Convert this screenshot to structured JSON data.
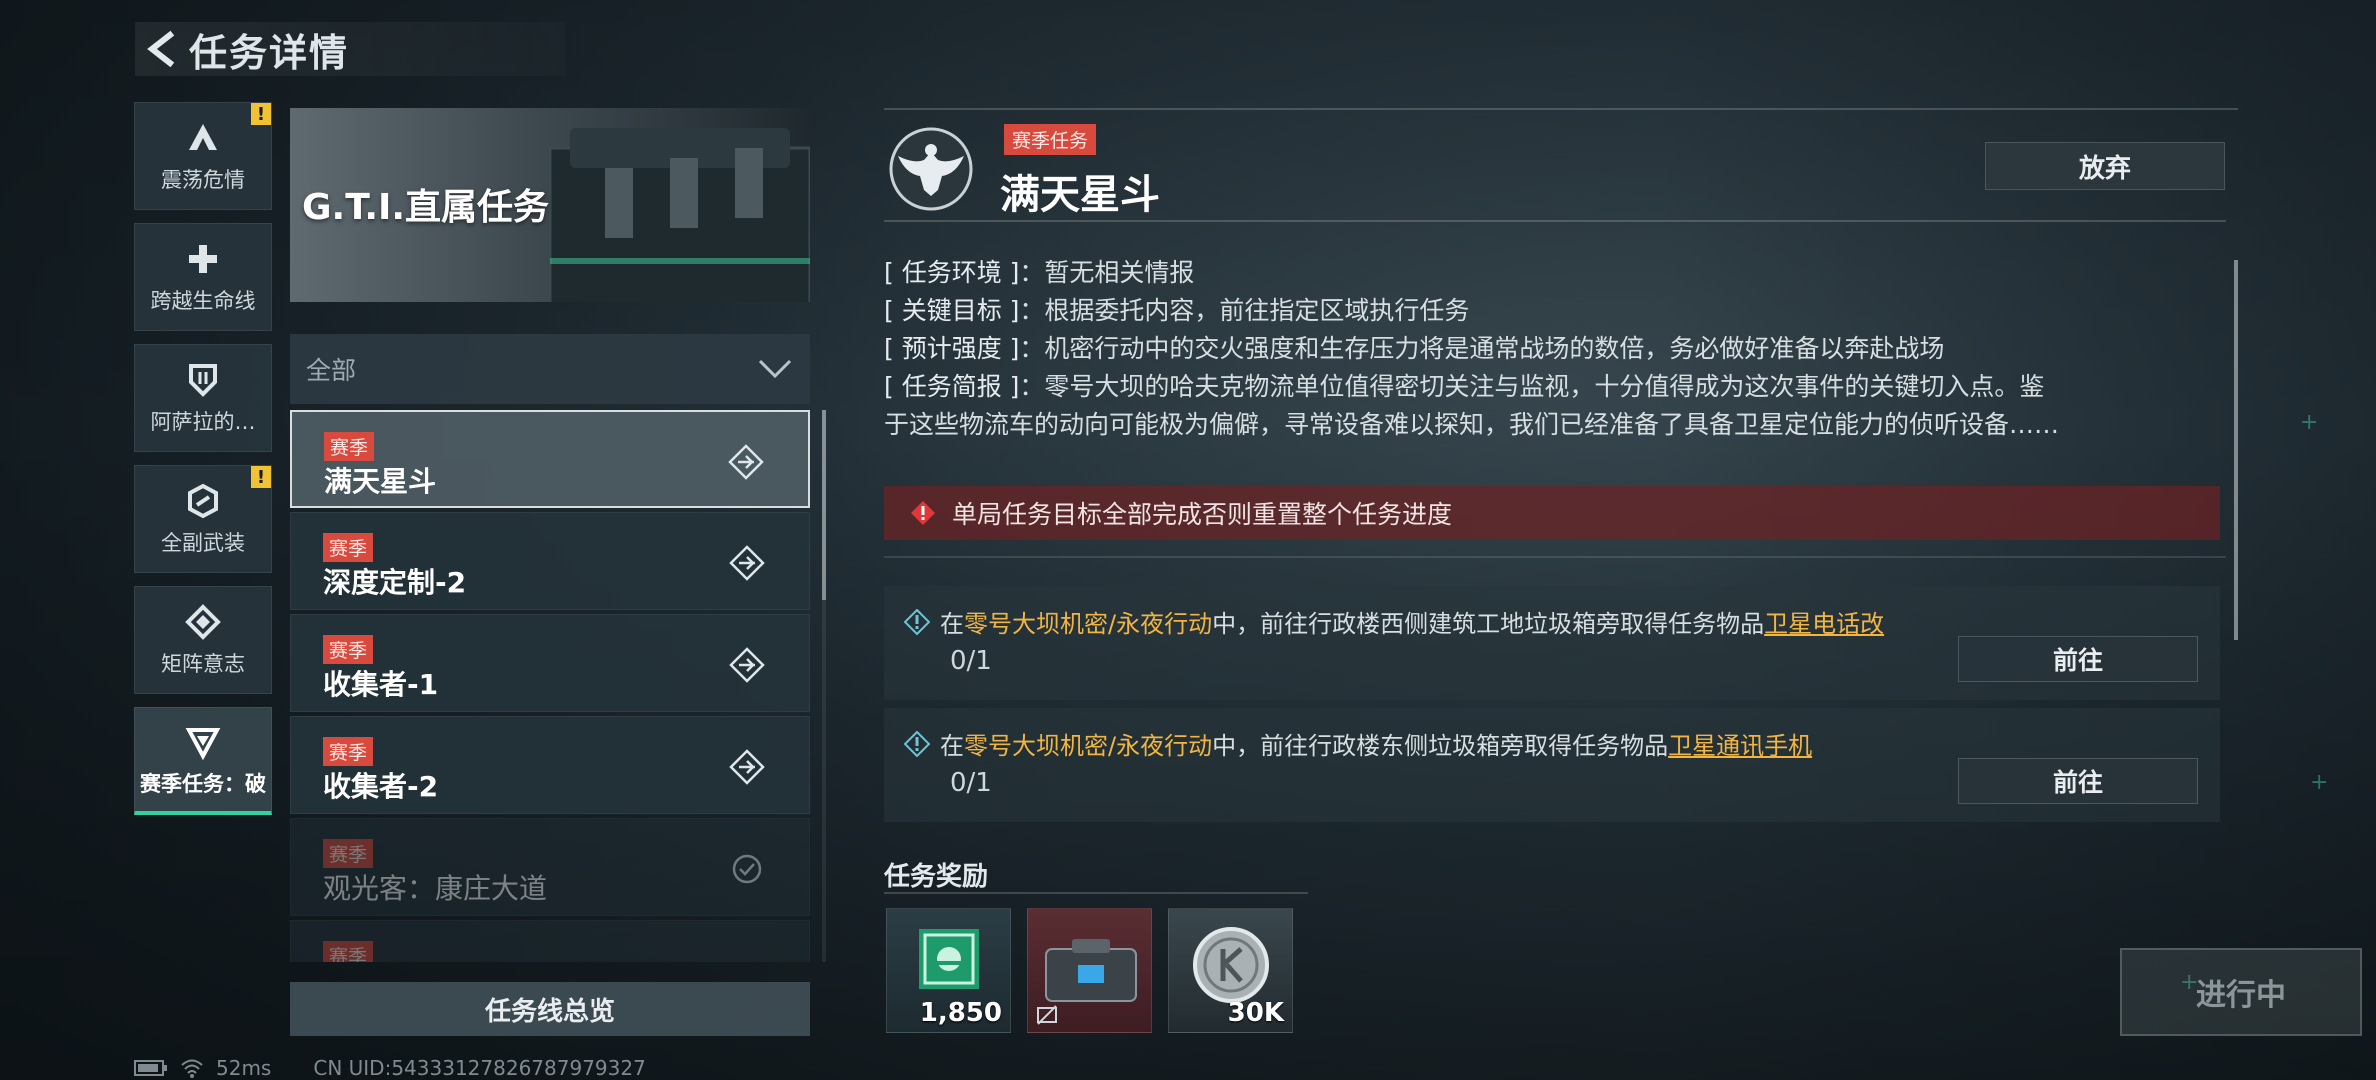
{
  "header": {
    "title": "任务详情"
  },
  "categories": [
    {
      "label": "震荡危情",
      "icon": "shock-icon",
      "warning": true
    },
    {
      "label": "跨越生命线",
      "icon": "cross-icon",
      "warning": false
    },
    {
      "label": "阿萨拉的…",
      "icon": "shield-icon",
      "warning": false
    },
    {
      "label": "全副武装",
      "icon": "armor-icon",
      "warning": true
    },
    {
      "label": "矩阵意志",
      "icon": "matrix-icon",
      "warning": false
    },
    {
      "label": "赛季任务：破",
      "icon": "season-icon",
      "warning": false,
      "active": true
    }
  ],
  "banner": {
    "title": "G.T.I.直属任务"
  },
  "filter": {
    "selected": "全部"
  },
  "tasks": [
    {
      "tag": "赛季",
      "name": "满天星斗",
      "state": "selected"
    },
    {
      "tag": "赛季",
      "name": "深度定制-2",
      "state": "normal"
    },
    {
      "tag": "赛季",
      "name": "收集者-1",
      "state": "normal"
    },
    {
      "tag": "赛季",
      "name": "收集者-2",
      "state": "normal"
    },
    {
      "tag": "赛季",
      "name": "观光客：康庄大道",
      "state": "done"
    },
    {
      "tag": "赛季",
      "name": "",
      "state": "done"
    }
  ],
  "overview_button": "任务线总览",
  "status": {
    "ping": "52ms",
    "uid": "CN UID:5433312782678797932​7"
  },
  "detail": {
    "tag": "赛季任务",
    "title": "满天星斗",
    "abandon_label": "放弃",
    "info": [
      {
        "key": "[ 任务环境 ]",
        "value": "暂无相关情报"
      },
      {
        "key": "[ 关键目标 ]",
        "value": "根据委托内容，前往指定区域执行任务"
      },
      {
        "key": "[ 预计强度 ]",
        "value": "机密行动中的交火强度和生存压力将是通常战场的数倍，务必做好准备以奔赴战场"
      },
      {
        "key": "[ 任务简报 ]",
        "value": "零号大坝的哈夫克物流单位值得密切关注与监视，十分值得成为这次事件的关键切入点。鉴"
      }
    ],
    "info_continued": "于这些物流车的动向可能极为偏僻，寻常设备难以探知，我们已经准备了具备卫星定位能力的侦听设备……",
    "warning": "单局任务目标全部完成否则重置整个任务进度",
    "objectives": [
      {
        "prefix": "在",
        "location": "零号大坝机密/永夜行动",
        "middle": "中，前往行政楼西侧建筑工地垃圾箱旁取得任务物品",
        "item": "卫星电话改",
        "progress": "0/1",
        "goto": "前往"
      },
      {
        "prefix": "在",
        "location": "零号大坝机密/永夜行动",
        "middle": "中，前往行政楼东侧垃圾箱旁取得任务物品",
        "item": "卫星通讯手机",
        "progress": "0/1",
        "goto": "前往"
      }
    ],
    "reward_title": "任务奖励",
    "rewards": [
      {
        "icon": "emblem-currency-icon",
        "qty": "1,850"
      },
      {
        "icon": "equipment-case-icon",
        "qty": ""
      },
      {
        "icon": "coin-icon",
        "qty": "30K"
      }
    ],
    "status_button": "进行中"
  },
  "colors": {
    "accent": "#33d19b",
    "tag": "#d94a3e",
    "highlight": "#f2b544",
    "warning_bg": "#6e2224"
  }
}
